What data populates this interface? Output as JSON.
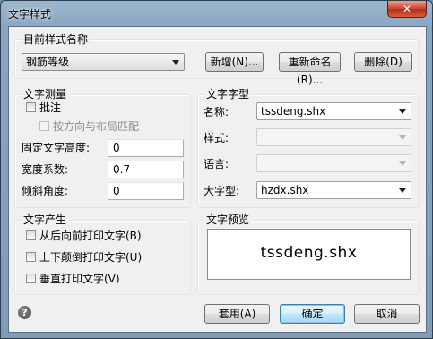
{
  "window": {
    "title": "文字样式",
    "close_glyph": "✕"
  },
  "style_group": {
    "label": "目前样式名称",
    "selected_style": "钢筋等级",
    "new_button": "新增(N)...",
    "rename_button": "重新命名(R)...",
    "delete_button": "删除(D)"
  },
  "measure_group": {
    "label": "文字测量",
    "annotative_label": "批注",
    "orientation_label": "按方向与布局匹配",
    "height_label": "固定文字高度:",
    "height_value": "0",
    "width_label": "宽度系数:",
    "width_value": "0.7",
    "oblique_label": "倾斜角度:",
    "oblique_value": "0"
  },
  "font_group": {
    "label": "文字字型",
    "name_label": "名称:",
    "name_value": "tssdeng.shx",
    "style_label": "样式:",
    "style_value": "",
    "language_label": "语言:",
    "language_value": "",
    "bigfont_label": "大字型:",
    "bigfont_value": "hzdx.shx"
  },
  "generation_group": {
    "label": "文字产生",
    "backwards_label": "从后向前打印文字(B)",
    "upside_down_label": "上下颠倒打印文字(U)",
    "vertical_label": "垂直打印文字(V)"
  },
  "preview_group": {
    "label": "文字预览",
    "preview_text": "tssdeng.shx"
  },
  "footer": {
    "help_glyph": "?",
    "apply_button": "套用(A)",
    "ok_button": "确定",
    "cancel_button": "取消"
  }
}
